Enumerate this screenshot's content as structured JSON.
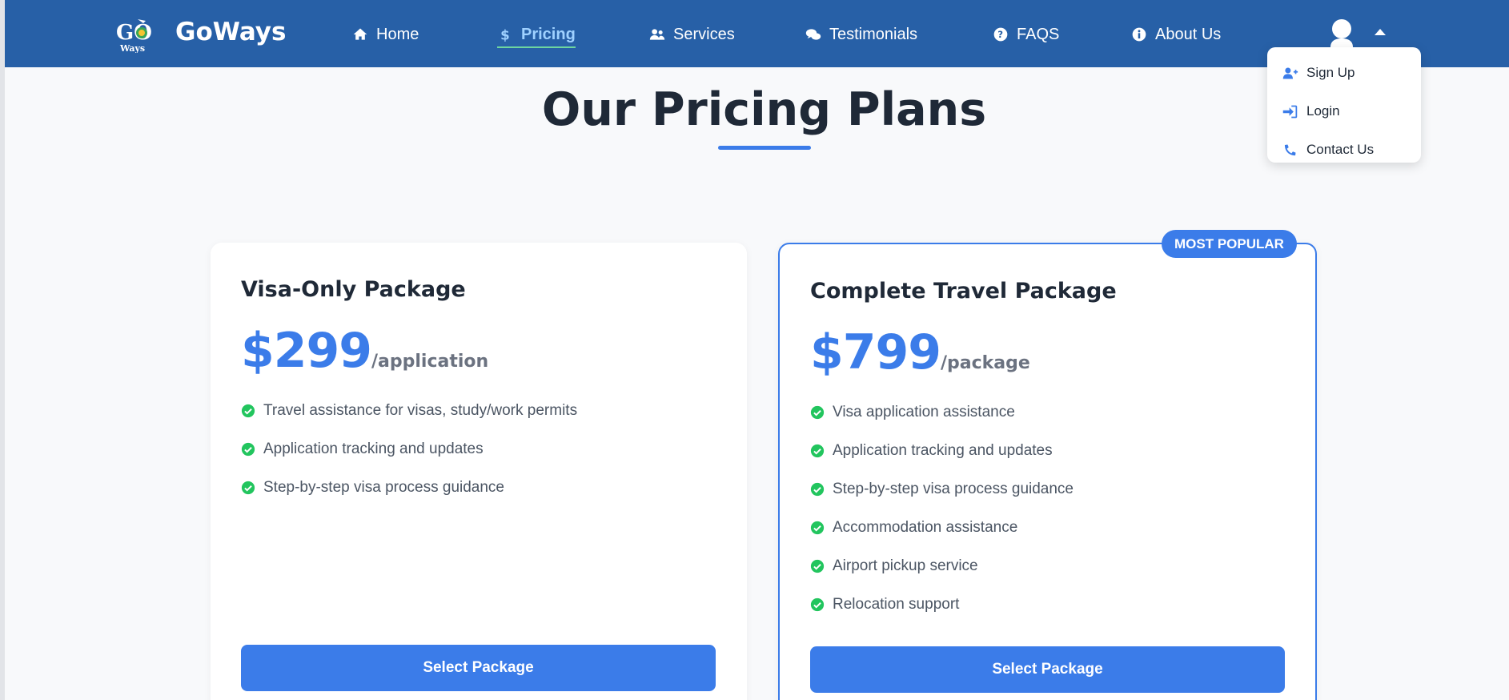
{
  "brand": {
    "name": "GoWays",
    "logo_text": "GO",
    "logo_subtext": "Ways"
  },
  "nav": {
    "items": [
      {
        "label": "Home",
        "icon": "home-icon"
      },
      {
        "label": "Pricing",
        "icon": "dollar-icon",
        "active": true
      },
      {
        "label": "Services",
        "icon": "users-icon"
      },
      {
        "label": "Testimonials",
        "icon": "comments-icon"
      },
      {
        "label": "FAQS",
        "icon": "question-circle-icon"
      },
      {
        "label": "About Us",
        "icon": "info-circle-icon"
      }
    ]
  },
  "user_menu": {
    "icon": "user-avatar-icon",
    "items": [
      {
        "label": "Sign Up",
        "icon": "user-plus-icon"
      },
      {
        "label": "Login",
        "icon": "sign-in-icon"
      },
      {
        "label": "Contact Us",
        "icon": "phone-icon"
      }
    ]
  },
  "page": {
    "title": "Our Pricing Plans"
  },
  "plans": [
    {
      "title": "Visa-Only Package",
      "price": "$299",
      "unit": "/application",
      "features": [
        "Travel assistance for visas, study/work permits",
        "Application tracking and updates",
        "Step-by-step visa process guidance"
      ],
      "button": "Select Package"
    },
    {
      "badge": "MOST POPULAR",
      "title": "Complete Travel Package",
      "price": "$799",
      "unit": "/package",
      "features": [
        "Visa application assistance",
        "Application tracking and updates",
        "Step-by-step visa process guidance",
        "Accommodation assistance",
        "Airport pickup service",
        "Relocation support"
      ],
      "button": "Select Package"
    }
  ],
  "colors": {
    "navbar": "#2760a7",
    "accent": "#3b7ce9",
    "check": "#22c55e",
    "active_nav": "#9fd1ff"
  }
}
